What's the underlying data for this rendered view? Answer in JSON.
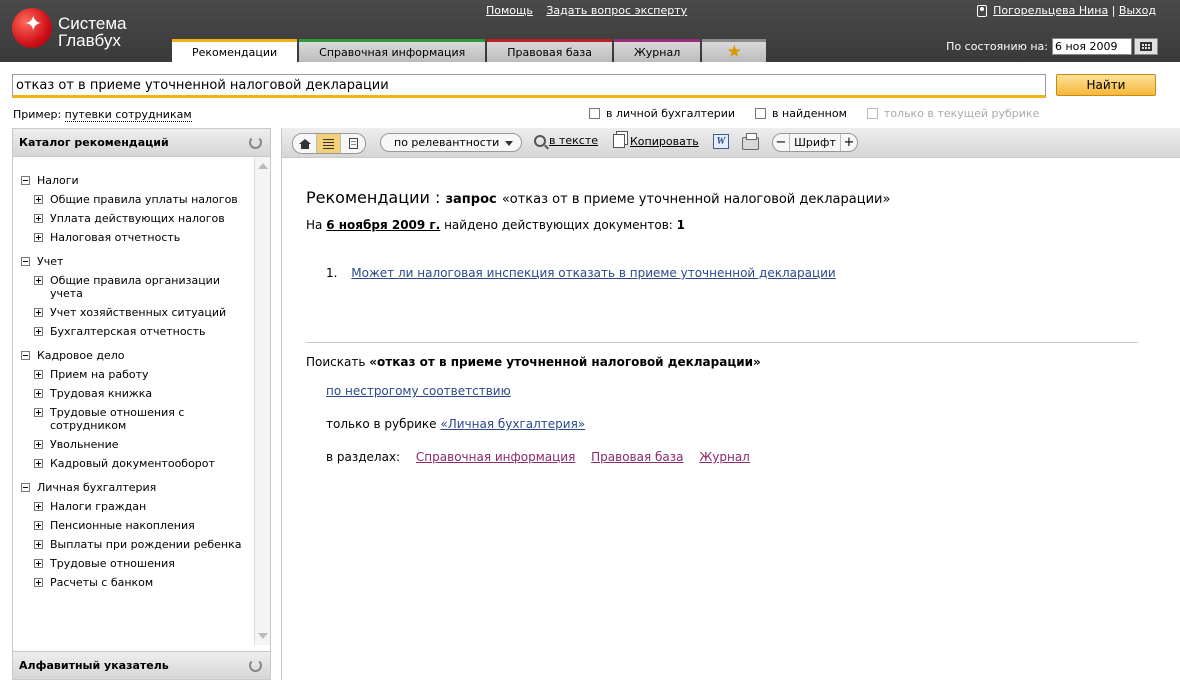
{
  "header": {
    "logo_line1": "Система",
    "logo_line2": "Главбух",
    "links": [
      "Помощь",
      "Задать вопрос эксперту"
    ],
    "user_name": "Погорельцева Нина",
    "logout": "Выход",
    "separator": "|",
    "tabs": [
      {
        "label": "Рекомендации",
        "active": true
      },
      {
        "label": "Справочная информация"
      },
      {
        "label": "Правовая база"
      },
      {
        "label": "Журнал"
      },
      {
        "label": "★",
        "icon": "star-icon"
      }
    ],
    "date_label": "По состоянию на:",
    "date_value": "6 ноя 2009"
  },
  "search": {
    "query": "отказ от в приеме уточненной налоговой декларации",
    "button": "Найти",
    "example_label": "Пример:",
    "example_link": "путевки сотрудникам",
    "options": [
      {
        "label": "в личной бухгалтерии",
        "disabled": false
      },
      {
        "label": "в найденном",
        "disabled": false
      },
      {
        "label": "только в текущей рубрике",
        "disabled": true
      }
    ]
  },
  "sidebar": {
    "title": "Каталог рекомендаций",
    "footer": "Алфавитный указатель",
    "groups": [
      {
        "label": "Налоги",
        "items": [
          "Общие правила уплаты налогов",
          "Уплата действующих налогов",
          "Налоговая отчетность"
        ]
      },
      {
        "label": "Учет",
        "items": [
          "Общие правила организации учета",
          "Учет хозяйственных ситуаций",
          "Бухгалтерская отчетность"
        ]
      },
      {
        "label": "Кадровое дело",
        "items": [
          "Прием на работу",
          "Трудовая книжка",
          "Трудовые отношения с сотрудником",
          "Увольнение",
          "Кадровый документооборот"
        ]
      },
      {
        "label": "Личная бухгалтерия",
        "items": [
          "Налоги граждан",
          "Пенсионные накопления",
          "Выплаты при рождении ребенка",
          "Трудовые отношения",
          "Расчеты с банком"
        ]
      }
    ]
  },
  "toolbar": {
    "sort": "по релевантности",
    "in_text": "в тексте",
    "copy": "Копировать",
    "font": "Шрифт",
    "font_minus": "−",
    "font_plus": "+",
    "word_letter": "W"
  },
  "content": {
    "title": "Рекомендации :",
    "query_label": "запрос",
    "query_text": "«отказ от в приеме уточненной налоговой декларации»",
    "found_prefix": "На",
    "found_date": "6 ноября 2009 г.",
    "found_mid": "найдено действующих документов:",
    "found_count": "1",
    "results": [
      {
        "num": "1.",
        "title": "Может ли налоговая инспекция отказать в приеме уточненной декларации"
      }
    ],
    "alt_prefix": "Поискать",
    "alt_query": "«отказ от в приеме уточненной налоговой декларации»",
    "alt_loose": "по нестрогому соответствию",
    "alt_rubric_prefix": "только в рубрике",
    "alt_rubric": "«Личная бухгалтерия»",
    "alt_sections_prefix": "в разделах:",
    "alt_sections": [
      "Справочная информация",
      "Правовая база",
      "Журнал"
    ]
  },
  "colors": {
    "accent": "#f2b21a",
    "header_bg": "#3a3a3a",
    "link": "#2a4a8a",
    "visited": "#8a2a6a"
  }
}
